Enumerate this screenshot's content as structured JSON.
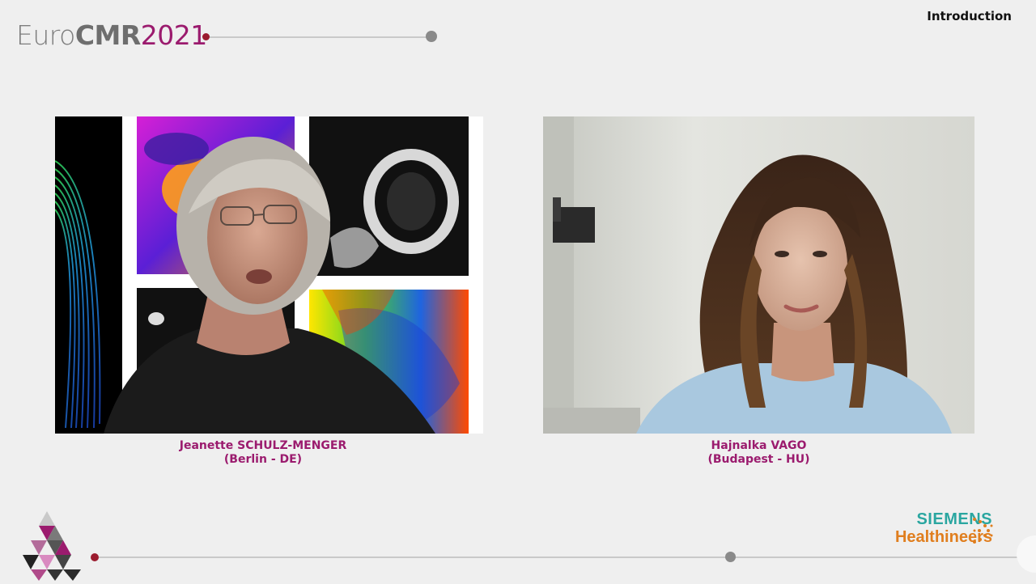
{
  "header": {
    "brand_part1": "Euro",
    "brand_part2": "CMR",
    "brand_part3": "2021",
    "section_title": "Introduction"
  },
  "participants": [
    {
      "name": "Jeanette SCHULZ-MENGER",
      "location": "(Berlin - DE)"
    },
    {
      "name": "Hajnalka VAGO",
      "location": "(Budapest - HU)"
    }
  ],
  "sponsor": {
    "line1": "SIEMENS",
    "line2": "Healthineers"
  },
  "colors": {
    "accent": "#9b1b6e",
    "background": "#efefef",
    "line": "#c9c9c9",
    "dot_gray": "#8a8a8a",
    "sponsor_teal": "#2aa6a0",
    "sponsor_orange": "#e07e1e"
  },
  "icons": {
    "logo": "eurocmr-triangle-logo",
    "sponsor_mark": "siemens-dots-icon"
  }
}
